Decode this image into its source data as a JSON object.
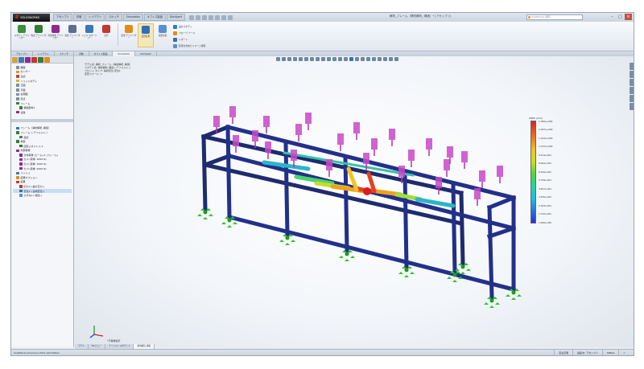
{
  "app": {
    "logo_text": "SOLIDWORKS",
    "document_title": "解析_フレーム（静的解析_ 構造）* [アセンブリ]",
    "search_placeholder": "SolidWorks 検索",
    "window_controls": [
      "–",
      "□",
      "×"
    ]
  },
  "menus": [
    "アセンブリ",
    "評価",
    "レイアウト",
    "スケッチ",
    "Simulation",
    "オフィス製品",
    "DimXpert"
  ],
  "quick_access_icons": [
    "new-icon",
    "open-icon",
    "save-icon",
    "print-icon",
    "undo-icon",
    "rebuild-icon",
    "options-icon"
  ],
  "ribbon": {
    "buttons": [
      {
        "name": "study-advisor-button",
        "label": "スタディ アドバイザー",
        "color": "#3c8f3c"
      },
      {
        "name": "fixture-button",
        "label": "拘束 アドバイザー",
        "color": "#2e7d32"
      },
      {
        "name": "external-loads-button",
        "label": "外部荷重 アドバイザー",
        "color": "#8e2a8e"
      },
      {
        "name": "connections-button",
        "label": "接続 アドバイザー",
        "color": "#5b6e90"
      },
      {
        "name": "shell-manager-button",
        "label": "シェル マネージャー",
        "color": "#3d77b5"
      },
      {
        "name": "run-button",
        "label": "実行",
        "color": "#c0392b"
      },
      {
        "name": "results-advisor-button",
        "label": "結果 アドバイザー",
        "color": "#e08e1b"
      },
      {
        "name": "deformed-result-button",
        "label": "変形結果",
        "color": "#2f6fb3"
      },
      {
        "name": "compare-results-button",
        "label": "結果比較",
        "color": "#5a8fd0"
      }
    ],
    "small_rows": [
      "設計スタディ",
      "プローブ ツール",
      "レポート",
      "結果を含めたイメージ保存"
    ]
  },
  "tabs": [
    "アセンブリ",
    "レイアウト",
    "スケッチ",
    "評価",
    "オフィス製品",
    "Simulation",
    "DimXpert"
  ],
  "active_tab_index": 5,
  "tree": {
    "top_items": [
      {
        "label": "履歴",
        "level": 1,
        "color": "#7a8ea8"
      },
      {
        "label": "センサー",
        "level": 1,
        "color": "#d79b1d"
      },
      {
        "label": "注記",
        "level": 1,
        "color": "#b2473e"
      },
      {
        "label": "ソリッドボディ",
        "level": 1,
        "color": "#e0b11c"
      },
      {
        "label": "正面",
        "level": 1,
        "color": "#7a8ea8"
      },
      {
        "label": "平面",
        "level": 1,
        "color": "#7a8ea8"
      },
      {
        "label": "右側面",
        "level": 1,
        "color": "#7a8ea8"
      },
      {
        "label": "原点",
        "level": 1,
        "color": "#7a8ea8"
      },
      {
        "label": "フレーム",
        "level": 1,
        "color": "#3a7a3a"
      },
      {
        "label": "構造部材1",
        "level": 2,
        "color": "#3a7a3a"
      },
      {
        "label": "合致",
        "level": 1,
        "color": "#8e2a8e"
      }
    ],
    "study_items": [
      {
        "label": "フレーム（静的解析_構造）",
        "level": 1,
        "color": "#2f6fb3"
      },
      {
        "label": "フレーム（-デフォルト-）",
        "level": 1,
        "color": "#3a7a3a"
      },
      {
        "label": "接続",
        "level": 2,
        "color": "#5b6e90"
      },
      {
        "label": "拘束",
        "level": 1,
        "color": "#2e7d32"
      },
      {
        "label": "固定ジオメトリ-1",
        "level": 2,
        "color": "#2e7d32"
      },
      {
        "label": "外部荷重",
        "level": 1,
        "color": "#8e2a8e"
      },
      {
        "label": "分布荷重 (ビーム)-1 (フレーム)",
        "level": 2,
        "color": "#8e2a8e"
      },
      {
        "label": "力-1 (荷重: 2000 N)",
        "level": 2,
        "color": "#8e2a8e"
      },
      {
        "label": "力-2 (荷重: 2000 N)",
        "level": 2,
        "color": "#8e2a8e"
      },
      {
        "label": "力-3 (荷重: 2000 N)",
        "level": 2,
        "color": "#8e2a8e"
      },
      {
        "label": "メッシュ",
        "level": 1,
        "color": "#3d77b5"
      },
      {
        "label": "結果オプション",
        "level": 1,
        "color": "#e08e1b"
      },
      {
        "label": "結果",
        "level": 1,
        "color": "#c0392b"
      },
      {
        "label": "応力1 (-曲げ応力-)",
        "level": 2,
        "color": "#c0392b"
      },
      {
        "label": "変位1 (-合成変位-)",
        "level": 2,
        "color": "#2f6fb3",
        "selected": true
      },
      {
        "label": "ひずみ1 (-相当-)",
        "level": 2,
        "color": "#5a8fd0"
      }
    ]
  },
  "viewport": {
    "info_lines": [
      "モデル名: 解析_フレーム（静的解析_構造）",
      "スタディ名: 静的解析_構造 (-デフォルト-)",
      "プロット タイプ: 静的変位 変位1",
      "変形スケール: 1"
    ],
    "legend": {
      "title": "URES (mm)",
      "labels": [
        "1.382e+000",
        "1.267e+000",
        "1.152e+000",
        "1.037e+000",
        "9.214e-001",
        "8.062e-001",
        "6.910e-001",
        "5.759e-001",
        "4.607e-001",
        "3.455e-001",
        "2.303e-001",
        "1.152e-001",
        "1.000e-030"
      ]
    },
    "view_label": "*不等角投影",
    "heads_up_count": 22
  },
  "bottom_tabs": [
    "モデル",
    "3D ビュー",
    "モーション スタディ 1",
    "静的解析_構造"
  ],
  "active_bottom_tab_index": 3,
  "status": {
    "left": "SolidWorks Premium 2014 x64 Edition",
    "right": [
      "完全定義",
      "編集中: アセンブリ",
      "MMGS",
      "?"
    ]
  }
}
